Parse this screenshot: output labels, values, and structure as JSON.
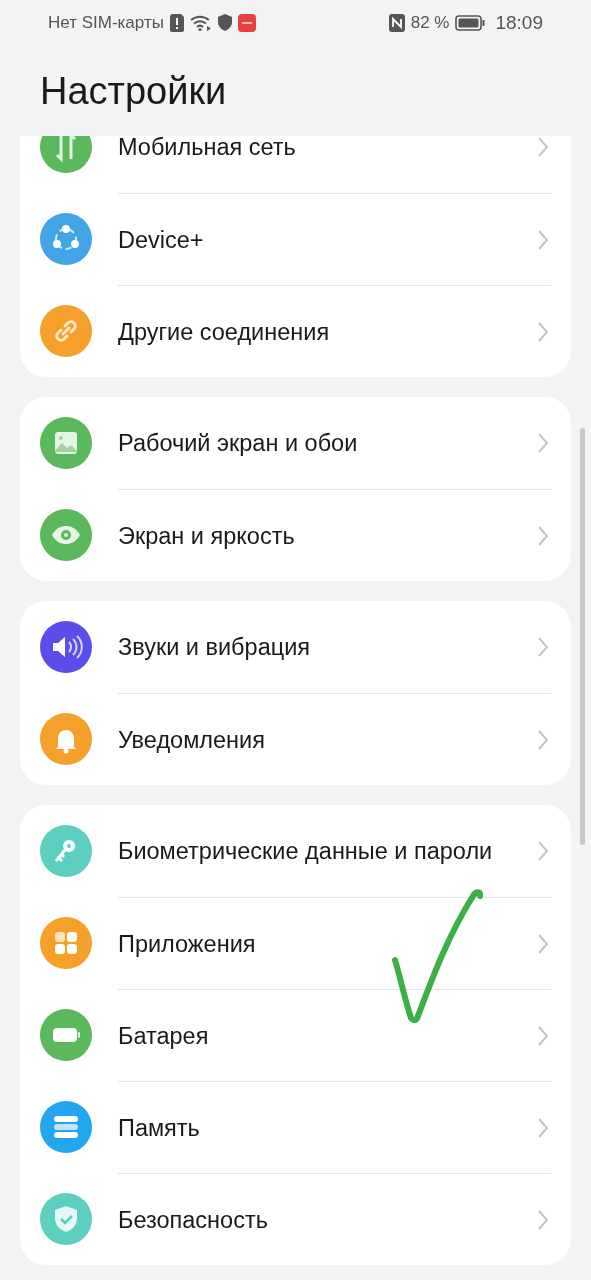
{
  "status_bar": {
    "carrier": "Нет SIM-карты",
    "battery": "82 %",
    "time": "18:09"
  },
  "title": "Настройки",
  "sections": [
    {
      "items": [
        {
          "label": "Мобильная сеть"
        },
        {
          "label": "Device+"
        },
        {
          "label": "Другие соединения"
        }
      ]
    },
    {
      "items": [
        {
          "label": "Рабочий экран и обои"
        },
        {
          "label": "Экран и яркость"
        }
      ]
    },
    {
      "items": [
        {
          "label": "Звуки и вибрация"
        },
        {
          "label": "Уведомления"
        }
      ]
    },
    {
      "items": [
        {
          "label": "Биометрические данные и пароли"
        },
        {
          "label": "Приложения"
        },
        {
          "label": "Батарея"
        },
        {
          "label": "Память"
        },
        {
          "label": "Безопасность"
        }
      ]
    }
  ]
}
